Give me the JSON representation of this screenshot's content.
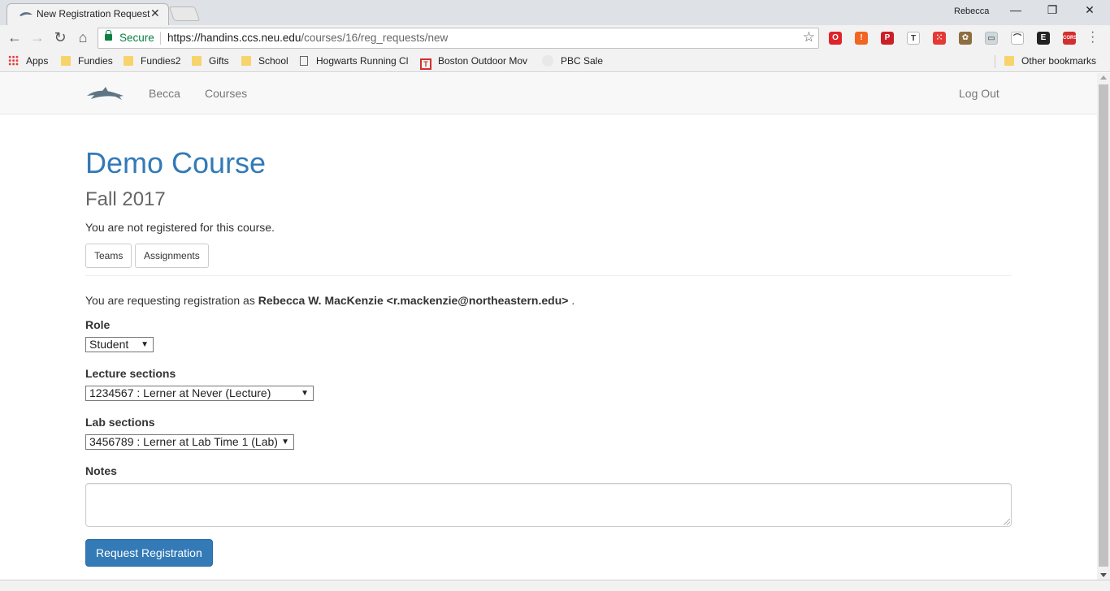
{
  "browser": {
    "tab_title": "New Registration Request",
    "profile_name": "Rebecca",
    "window_controls": {
      "minimize": "—",
      "restore": "❐",
      "close": "✕"
    },
    "omnibox": {
      "secure_label": "Secure",
      "url_host": "https://handins.ccs.neu.edu",
      "url_path": "/courses/16/reg_requests/new"
    },
    "extensions": [
      {
        "icon": "opera-icon",
        "color": "#e0242b",
        "glyph": "O"
      },
      {
        "icon": "alert-icon",
        "color": "#f26522",
        "glyph": "!"
      },
      {
        "icon": "pinterest-icon",
        "color": "#cb2027",
        "glyph": "P"
      },
      {
        "icon": "tooltip-icon",
        "color": "#ffffff",
        "glyph": "T"
      },
      {
        "icon": "dice-icon",
        "color": "#e53935",
        "glyph": "⁙"
      },
      {
        "icon": "plant-icon",
        "color": "#8d6e3f",
        "glyph": "✿"
      },
      {
        "icon": "chat-icon",
        "color": "#cfd8dc",
        "glyph": "▭"
      },
      {
        "icon": "bridge-icon",
        "color": "#ffffff",
        "glyph": "⌒"
      },
      {
        "icon": "evernote-icon",
        "color": "#222222",
        "glyph": "E"
      },
      {
        "icon": "cors-icon",
        "color": "#d32f2f",
        "glyph": "CORS"
      }
    ],
    "bookmarks": {
      "apps": "Apps",
      "items": [
        "Fundies",
        "Fundies2",
        "Gifts",
        "School",
        "Hogwarts Running Cl",
        "Boston Outdoor Mov",
        "PBC Sale"
      ],
      "other": "Other bookmarks"
    }
  },
  "navbar": {
    "user_link": "Becca",
    "courses_link": "Courses",
    "logout_link": "Log Out"
  },
  "course": {
    "title": "Demo Course",
    "term": "Fall 2017",
    "registration_status": "You are not registered for this course.",
    "buttons": {
      "teams": "Teams",
      "assignments": "Assignments"
    }
  },
  "form": {
    "request_prefix": "You are requesting registration as",
    "requester": "Rebecca W. MacKenzie <r.mackenzie@northeastern.edu>",
    "request_suffix": ".",
    "role_label": "Role",
    "role_value": "Student",
    "lecture_label": "Lecture sections",
    "lecture_value": "1234567 : Lerner at Never (Lecture)",
    "lab_label": "Lab sections",
    "lab_value": "3456789 : Lerner at Lab Time 1 (Lab)",
    "notes_label": "Notes",
    "notes_value": "",
    "submit_label": "Request Registration"
  }
}
